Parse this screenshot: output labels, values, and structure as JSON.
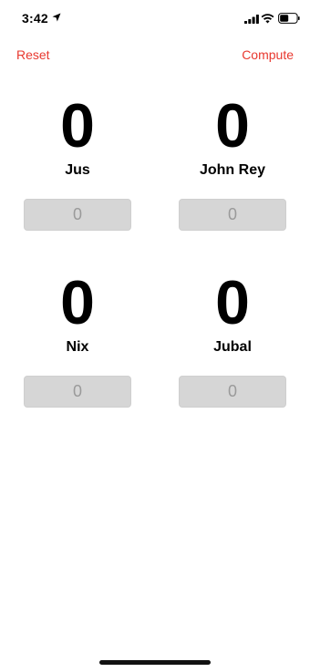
{
  "status_bar": {
    "time": "3:42",
    "icons": [
      "location-arrow-icon",
      "cell-signal-icon",
      "wifi-icon",
      "battery-icon"
    ]
  },
  "nav": {
    "reset_label": "Reset",
    "compute_label": "Compute",
    "accent_color": "#e8382f"
  },
  "players": [
    {
      "score": "0",
      "name": "Jus",
      "input_placeholder": "0"
    },
    {
      "score": "0",
      "name": "John Rey",
      "input_placeholder": "0"
    },
    {
      "score": "0",
      "name": "Nix",
      "input_placeholder": "0"
    },
    {
      "score": "0",
      "name": "Jubal",
      "input_placeholder": "0"
    }
  ],
  "colors": {
    "input_bg": "#d6d6d6",
    "input_text": "#9a9a9a"
  }
}
